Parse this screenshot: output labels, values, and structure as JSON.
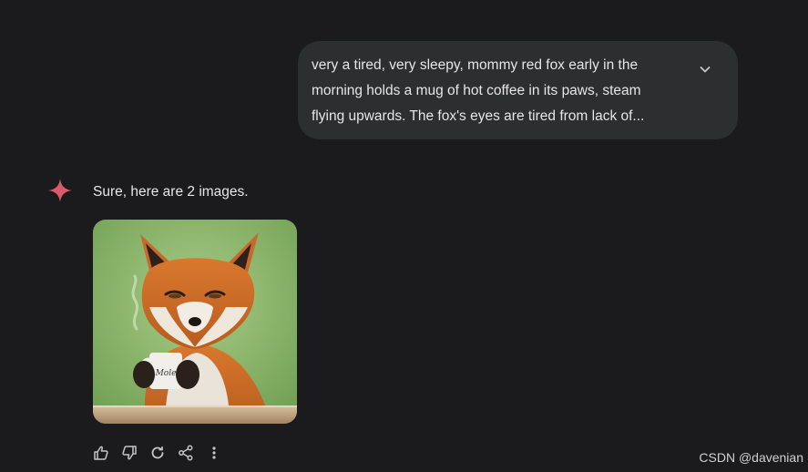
{
  "user_prompt": {
    "lines": [
      "very a tired, very sleepy, mommy red fox early in the",
      "morning holds a mug of hot coffee in its paws, steam",
      "flying upwards. The fox's eyes are tired from lack of..."
    ],
    "expand_icon": "chevron-down-icon"
  },
  "response": {
    "avatar_icon": "sparkle-icon",
    "text": "Sure, here are 2 images.",
    "images": [
      {
        "alt": "red fox holding coffee mug",
        "mug_text": "Mole"
      }
    ]
  },
  "actions": [
    {
      "name": "thumbs-up-icon"
    },
    {
      "name": "thumbs-down-icon"
    },
    {
      "name": "regenerate-icon"
    },
    {
      "name": "share-icon"
    },
    {
      "name": "more-vertical-icon"
    }
  ],
  "watermark": "CSDN @davenian",
  "colors": {
    "background": "#1b1b1d",
    "bubble": "#2d2e30",
    "text": "#e6e6e6",
    "sparkle": "#d95a6a",
    "icon": "#c4c7c5"
  }
}
